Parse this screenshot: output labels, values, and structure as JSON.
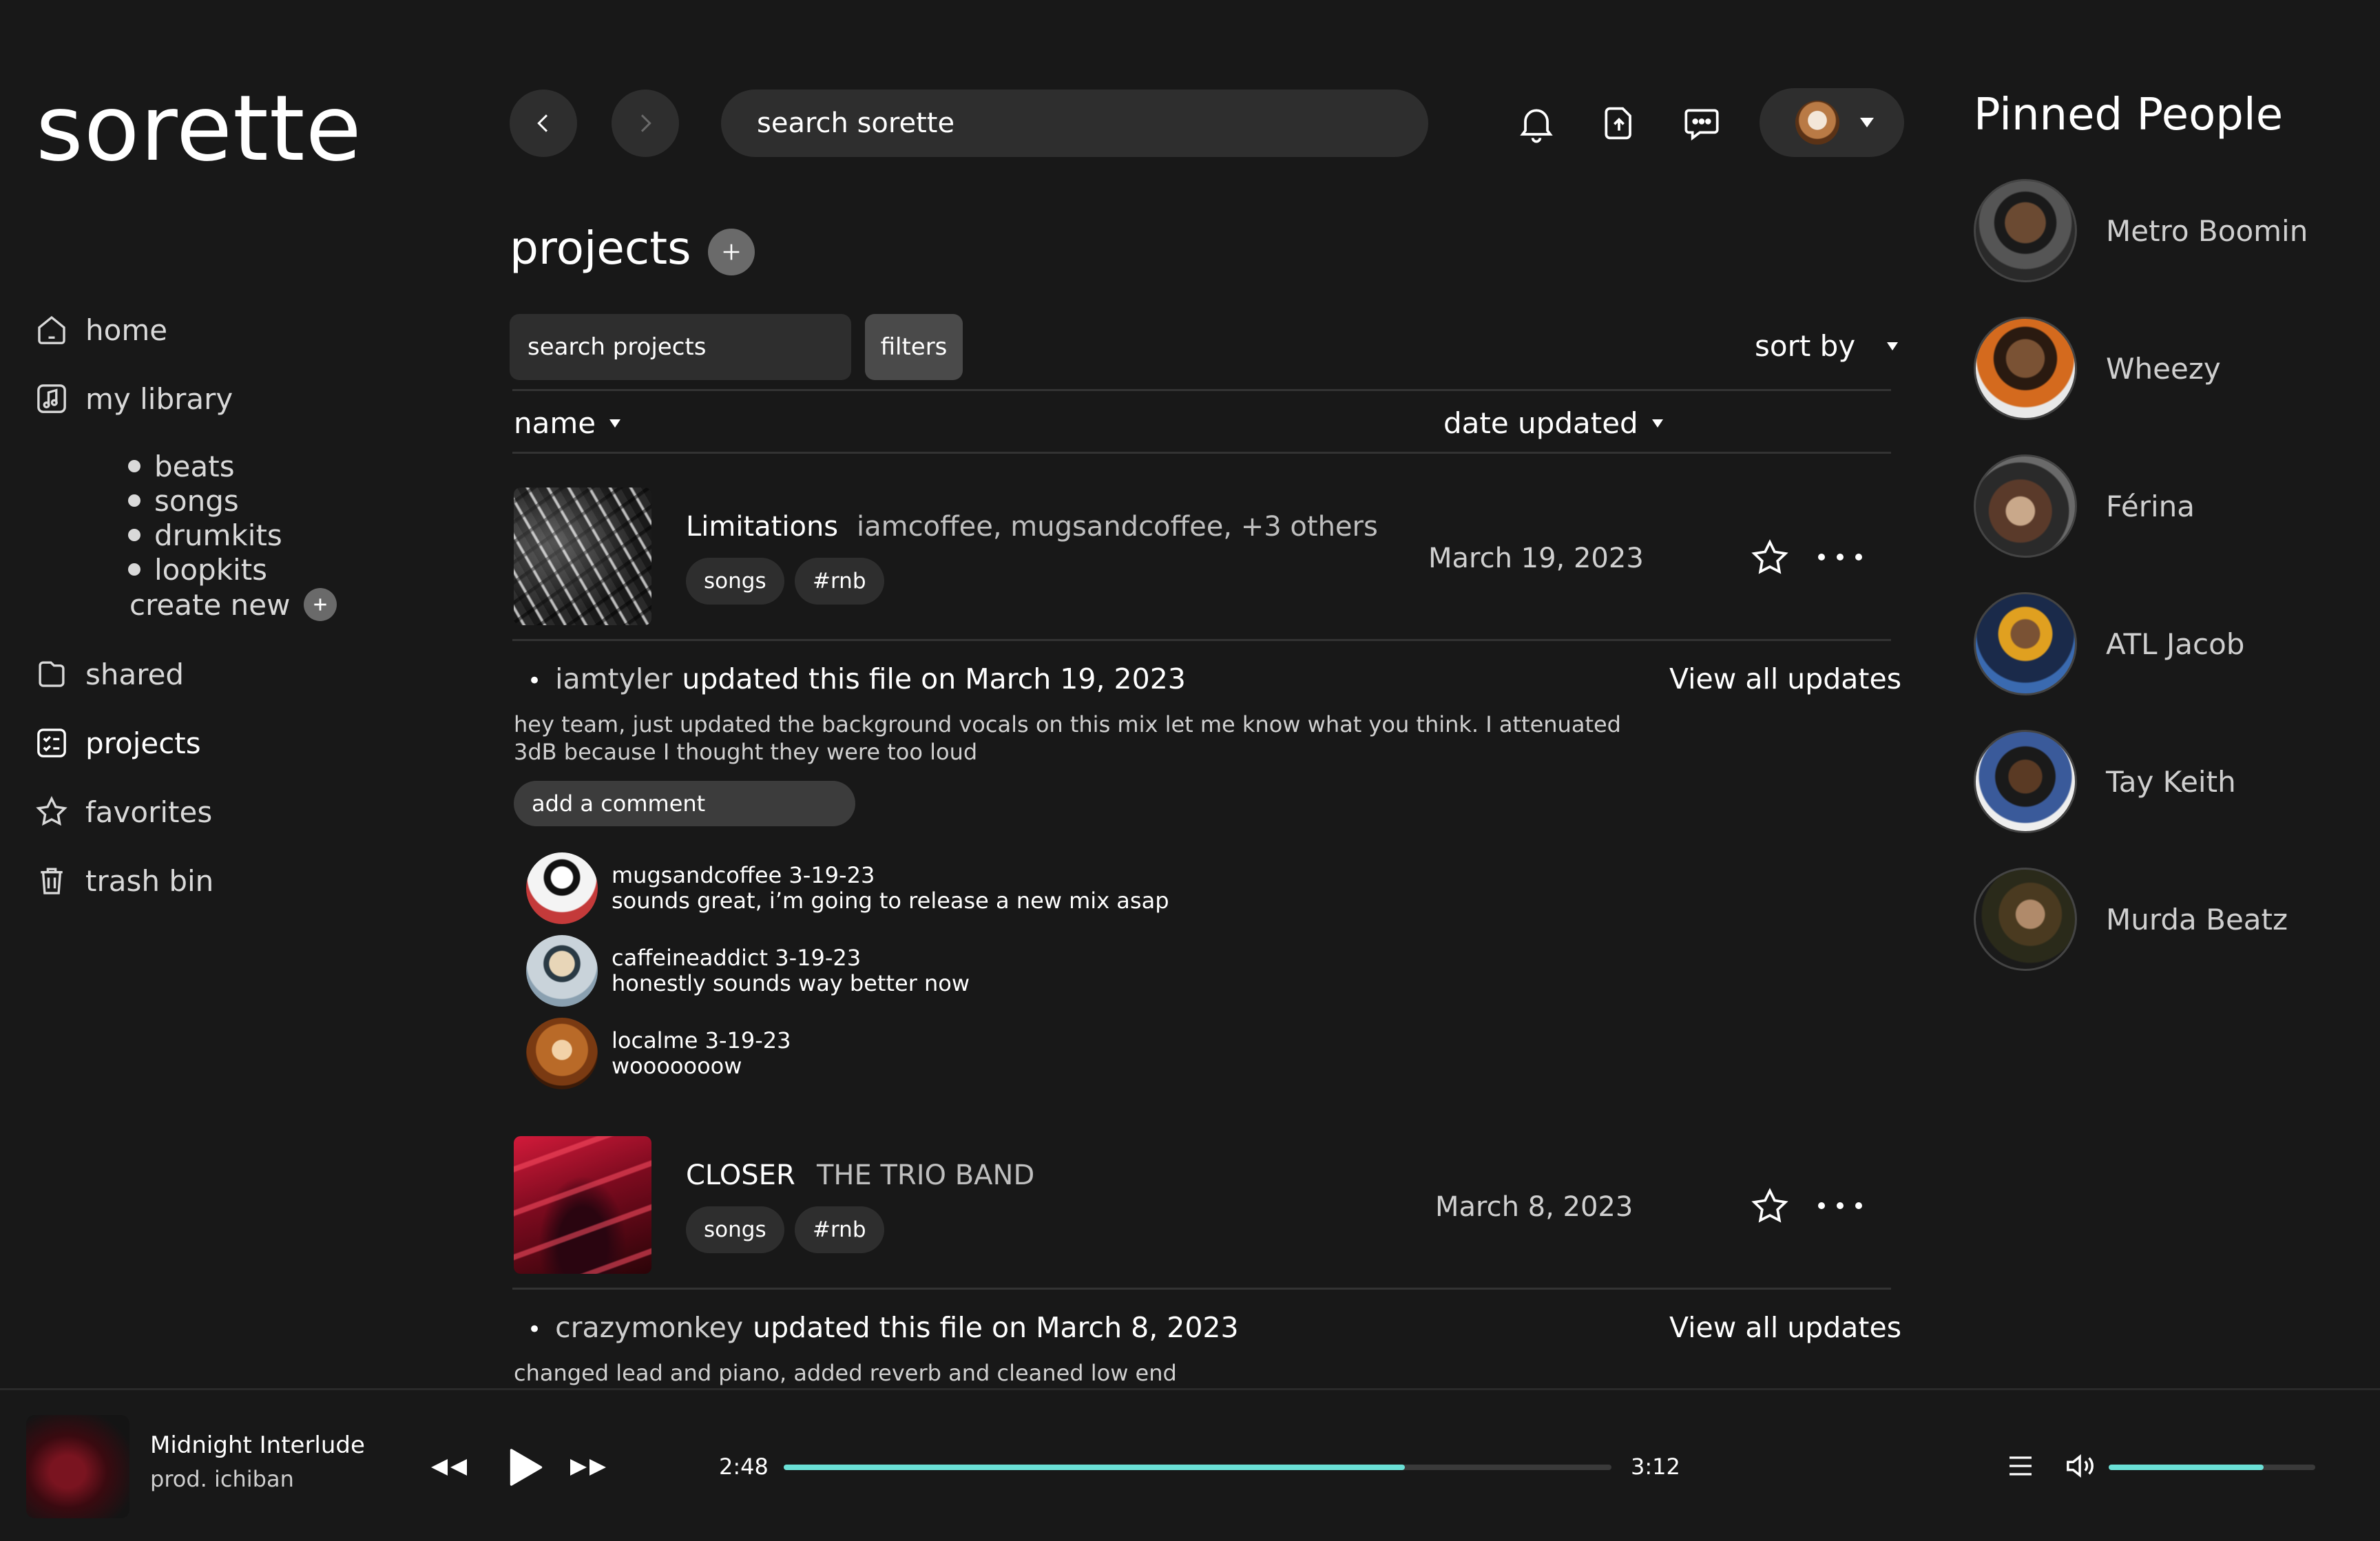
{
  "brand": {
    "logo": "sorette"
  },
  "sidebar": {
    "items": [
      {
        "label": "home",
        "icon": "home-icon"
      },
      {
        "label": "my library",
        "icon": "music-note-icon"
      },
      {
        "label": "shared",
        "icon": "folder-icon"
      },
      {
        "label": "projects",
        "icon": "checklist-icon"
      },
      {
        "label": "favorites",
        "icon": "star-icon"
      },
      {
        "label": "trash bin",
        "icon": "trash-icon"
      }
    ],
    "library_sub": [
      "beats",
      "songs",
      "drumkits",
      "loopkits"
    ],
    "create_new": "create new"
  },
  "topbar": {
    "search_placeholder": "search sorette",
    "icons": [
      "chevron-left-icon",
      "chevron-right-icon",
      "bell-icon",
      "upload-icon",
      "chat-icon"
    ]
  },
  "projects": {
    "title": "projects",
    "search_placeholder": "search projects",
    "filters_label": "filters",
    "sort_label": "sort by",
    "col_name": "name",
    "col_date": "date updated",
    "rows": [
      {
        "title": "Limitations",
        "collaborators": "iamcoffee, mugsandcoffee, +3 others",
        "tags": [
          "songs",
          "#rnb"
        ],
        "date": "March 19, 2023",
        "update_user": "iamtyler",
        "update_text": "updated this file on March 19, 2023",
        "view_all": "View all updates",
        "message": "hey team, just updated the background vocals on this mix let me know what you think. I attenuated 3dB because I thought they were too loud",
        "comment_placeholder": "add a comment",
        "comments": [
          {
            "user": "mugsandcoffee 3-19-23",
            "text": "sounds great, i’m going to release a new mix asap"
          },
          {
            "user": "caffeineaddict 3-19-23",
            "text": "honestly sounds way better now"
          },
          {
            "user": "localme 3-19-23",
            "text": "wooooooow"
          }
        ]
      },
      {
        "title": "CLOSER",
        "collaborators": "THE TRIO BAND",
        "tags": [
          "songs",
          "#rnb"
        ],
        "date": "March 8, 2023",
        "update_user": "crazymonkey",
        "update_text": "updated this file on March 8, 2023",
        "view_all": "View all updates",
        "message": "changed lead and piano, added reverb and cleaned low end"
      }
    ]
  },
  "pinned": {
    "title": "Pinned People",
    "people": [
      "Metro Boomin",
      "Wheezy",
      "Férina",
      "ATL Jacob",
      "Tay Keith",
      "Murda Beatz"
    ]
  },
  "player": {
    "title": "Midnight Interlude",
    "artist": "prod. ichiban",
    "elapsed": "2:48",
    "duration": "3:12",
    "progress_fraction": 0.75,
    "volume_fraction": 0.75,
    "accent": "#6be0d6"
  }
}
